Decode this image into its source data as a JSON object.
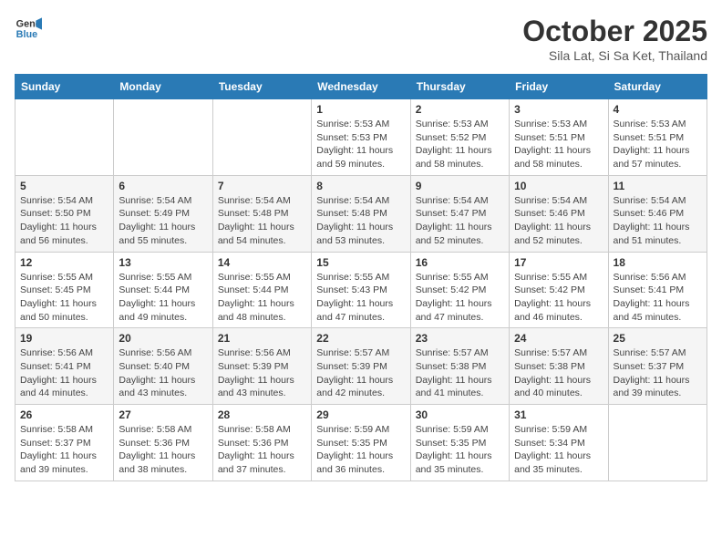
{
  "header": {
    "logo_line1": "General",
    "logo_line2": "Blue",
    "month": "October 2025",
    "location": "Sila Lat, Si Sa Ket, Thailand"
  },
  "weekdays": [
    "Sunday",
    "Monday",
    "Tuesday",
    "Wednesday",
    "Thursday",
    "Friday",
    "Saturday"
  ],
  "weeks": [
    [
      {
        "day": "",
        "sunrise": "",
        "sunset": "",
        "daylight": ""
      },
      {
        "day": "",
        "sunrise": "",
        "sunset": "",
        "daylight": ""
      },
      {
        "day": "",
        "sunrise": "",
        "sunset": "",
        "daylight": ""
      },
      {
        "day": "1",
        "sunrise": "Sunrise: 5:53 AM",
        "sunset": "Sunset: 5:53 PM",
        "daylight": "Daylight: 11 hours and 59 minutes."
      },
      {
        "day": "2",
        "sunrise": "Sunrise: 5:53 AM",
        "sunset": "Sunset: 5:52 PM",
        "daylight": "Daylight: 11 hours and 58 minutes."
      },
      {
        "day": "3",
        "sunrise": "Sunrise: 5:53 AM",
        "sunset": "Sunset: 5:51 PM",
        "daylight": "Daylight: 11 hours and 58 minutes."
      },
      {
        "day": "4",
        "sunrise": "Sunrise: 5:53 AM",
        "sunset": "Sunset: 5:51 PM",
        "daylight": "Daylight: 11 hours and 57 minutes."
      }
    ],
    [
      {
        "day": "5",
        "sunrise": "Sunrise: 5:54 AM",
        "sunset": "Sunset: 5:50 PM",
        "daylight": "Daylight: 11 hours and 56 minutes."
      },
      {
        "day": "6",
        "sunrise": "Sunrise: 5:54 AM",
        "sunset": "Sunset: 5:49 PM",
        "daylight": "Daylight: 11 hours and 55 minutes."
      },
      {
        "day": "7",
        "sunrise": "Sunrise: 5:54 AM",
        "sunset": "Sunset: 5:48 PM",
        "daylight": "Daylight: 11 hours and 54 minutes."
      },
      {
        "day": "8",
        "sunrise": "Sunrise: 5:54 AM",
        "sunset": "Sunset: 5:48 PM",
        "daylight": "Daylight: 11 hours and 53 minutes."
      },
      {
        "day": "9",
        "sunrise": "Sunrise: 5:54 AM",
        "sunset": "Sunset: 5:47 PM",
        "daylight": "Daylight: 11 hours and 52 minutes."
      },
      {
        "day": "10",
        "sunrise": "Sunrise: 5:54 AM",
        "sunset": "Sunset: 5:46 PM",
        "daylight": "Daylight: 11 hours and 52 minutes."
      },
      {
        "day": "11",
        "sunrise": "Sunrise: 5:54 AM",
        "sunset": "Sunset: 5:46 PM",
        "daylight": "Daylight: 11 hours and 51 minutes."
      }
    ],
    [
      {
        "day": "12",
        "sunrise": "Sunrise: 5:55 AM",
        "sunset": "Sunset: 5:45 PM",
        "daylight": "Daylight: 11 hours and 50 minutes."
      },
      {
        "day": "13",
        "sunrise": "Sunrise: 5:55 AM",
        "sunset": "Sunset: 5:44 PM",
        "daylight": "Daylight: 11 hours and 49 minutes."
      },
      {
        "day": "14",
        "sunrise": "Sunrise: 5:55 AM",
        "sunset": "Sunset: 5:44 PM",
        "daylight": "Daylight: 11 hours and 48 minutes."
      },
      {
        "day": "15",
        "sunrise": "Sunrise: 5:55 AM",
        "sunset": "Sunset: 5:43 PM",
        "daylight": "Daylight: 11 hours and 47 minutes."
      },
      {
        "day": "16",
        "sunrise": "Sunrise: 5:55 AM",
        "sunset": "Sunset: 5:42 PM",
        "daylight": "Daylight: 11 hours and 47 minutes."
      },
      {
        "day": "17",
        "sunrise": "Sunrise: 5:55 AM",
        "sunset": "Sunset: 5:42 PM",
        "daylight": "Daylight: 11 hours and 46 minutes."
      },
      {
        "day": "18",
        "sunrise": "Sunrise: 5:56 AM",
        "sunset": "Sunset: 5:41 PM",
        "daylight": "Daylight: 11 hours and 45 minutes."
      }
    ],
    [
      {
        "day": "19",
        "sunrise": "Sunrise: 5:56 AM",
        "sunset": "Sunset: 5:41 PM",
        "daylight": "Daylight: 11 hours and 44 minutes."
      },
      {
        "day": "20",
        "sunrise": "Sunrise: 5:56 AM",
        "sunset": "Sunset: 5:40 PM",
        "daylight": "Daylight: 11 hours and 43 minutes."
      },
      {
        "day": "21",
        "sunrise": "Sunrise: 5:56 AM",
        "sunset": "Sunset: 5:39 PM",
        "daylight": "Daylight: 11 hours and 43 minutes."
      },
      {
        "day": "22",
        "sunrise": "Sunrise: 5:57 AM",
        "sunset": "Sunset: 5:39 PM",
        "daylight": "Daylight: 11 hours and 42 minutes."
      },
      {
        "day": "23",
        "sunrise": "Sunrise: 5:57 AM",
        "sunset": "Sunset: 5:38 PM",
        "daylight": "Daylight: 11 hours and 41 minutes."
      },
      {
        "day": "24",
        "sunrise": "Sunrise: 5:57 AM",
        "sunset": "Sunset: 5:38 PM",
        "daylight": "Daylight: 11 hours and 40 minutes."
      },
      {
        "day": "25",
        "sunrise": "Sunrise: 5:57 AM",
        "sunset": "Sunset: 5:37 PM",
        "daylight": "Daylight: 11 hours and 39 minutes."
      }
    ],
    [
      {
        "day": "26",
        "sunrise": "Sunrise: 5:58 AM",
        "sunset": "Sunset: 5:37 PM",
        "daylight": "Daylight: 11 hours and 39 minutes."
      },
      {
        "day": "27",
        "sunrise": "Sunrise: 5:58 AM",
        "sunset": "Sunset: 5:36 PM",
        "daylight": "Daylight: 11 hours and 38 minutes."
      },
      {
        "day": "28",
        "sunrise": "Sunrise: 5:58 AM",
        "sunset": "Sunset: 5:36 PM",
        "daylight": "Daylight: 11 hours and 37 minutes."
      },
      {
        "day": "29",
        "sunrise": "Sunrise: 5:59 AM",
        "sunset": "Sunset: 5:35 PM",
        "daylight": "Daylight: 11 hours and 36 minutes."
      },
      {
        "day": "30",
        "sunrise": "Sunrise: 5:59 AM",
        "sunset": "Sunset: 5:35 PM",
        "daylight": "Daylight: 11 hours and 35 minutes."
      },
      {
        "day": "31",
        "sunrise": "Sunrise: 5:59 AM",
        "sunset": "Sunset: 5:34 PM",
        "daylight": "Daylight: 11 hours and 35 minutes."
      },
      {
        "day": "",
        "sunrise": "",
        "sunset": "",
        "daylight": ""
      }
    ]
  ]
}
